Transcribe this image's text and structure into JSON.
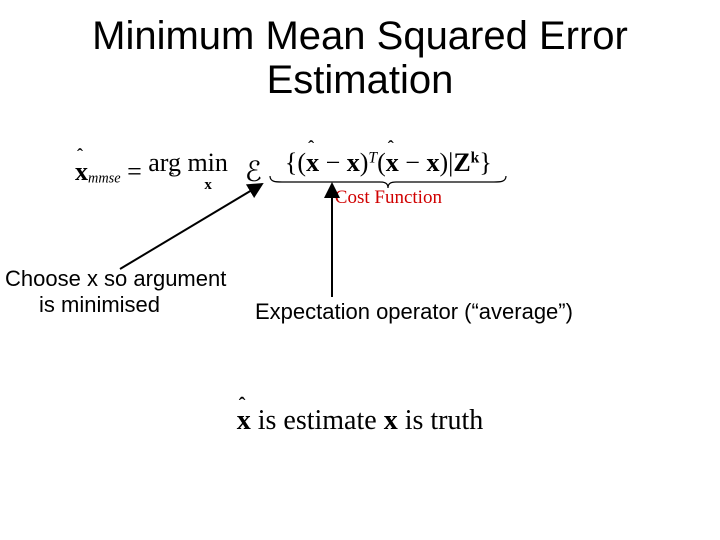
{
  "title_line1": "Minimum Mean Squared Error",
  "title_line2": "Estimation",
  "eq": {
    "xhat": "x",
    "mmse_sub": "mmse",
    "equals": " = ",
    "argmin": "arg min",
    "script_E": "ℰ",
    "lbrace": "{",
    "lp1": "(",
    "minus": " − ",
    "rp1": ")",
    "supT": "T",
    "lp2": "(",
    "rp2": ")",
    "bar": "|",
    "Z": "Z",
    "supk": "k",
    "rbrace": "}",
    "costfn": "Cost Function"
  },
  "caption1_line1": "Choose x so argument",
  "caption1_line2": "is minimised",
  "caption2": "Expectation operator (“average”)",
  "bottom": {
    "pre": " ",
    "is_estimate": " is estimate ",
    "is_truth": " is truth"
  }
}
